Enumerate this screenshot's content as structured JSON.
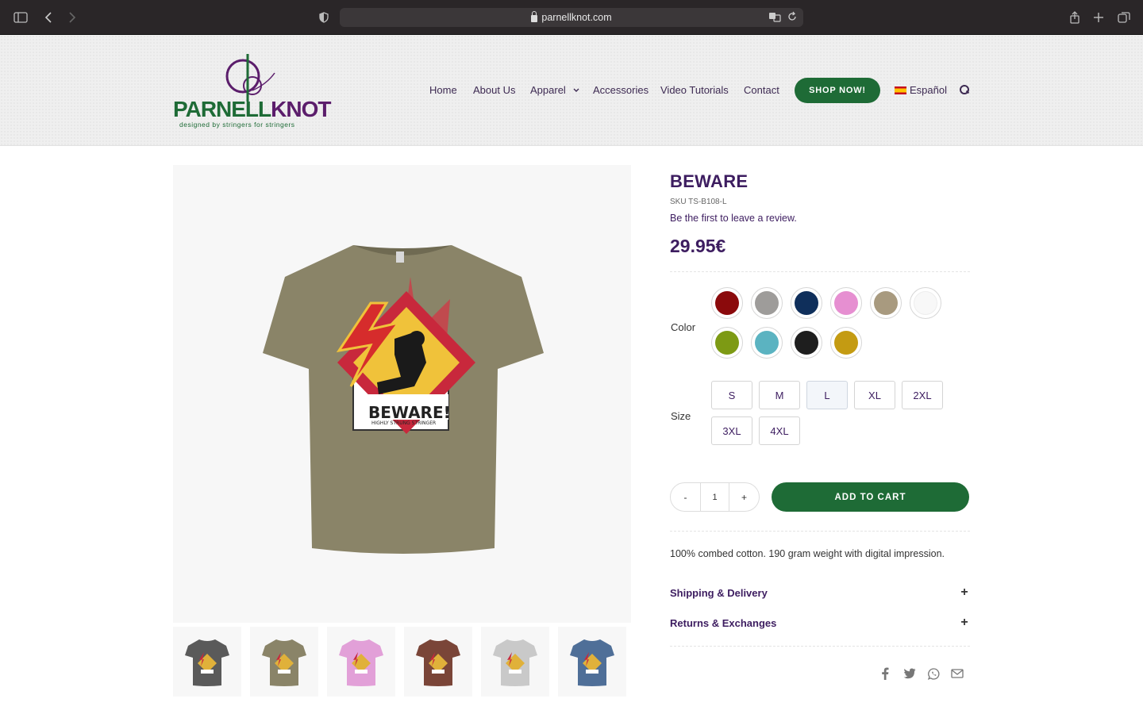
{
  "browser": {
    "url": "parnellknot.com"
  },
  "header": {
    "logo_brand_a": "PARNELL",
    "logo_brand_b": "KNOT",
    "logo_tagline": "designed by stringers for stringers",
    "nav": {
      "home": "Home",
      "about": "About Us",
      "apparel": "Apparel",
      "accessories": "Accessories",
      "tutorials": "Video Tutorials",
      "contact": "Contact",
      "shop": "SHOP NOW!",
      "language": "Español"
    }
  },
  "product": {
    "title": "BEWARE",
    "sku": "SKU TS-B108-L",
    "review_link": "Be the first to leave a review.",
    "price": "29.95€",
    "color_label": "Color",
    "colors": [
      "#8b0a0c",
      "#9e9c9a",
      "#0f2f5b",
      "#e68fd1",
      "#a89a7f",
      "#f8f8f8",
      "#7d9a14",
      "#5bb3c1",
      "#1e1e1e",
      "#c49b12"
    ],
    "size_label": "Size",
    "sizes": [
      "S",
      "M",
      "L",
      "XL",
      "2XL",
      "3XL",
      "4XL"
    ],
    "selected_size": "L",
    "quantity": "1",
    "qty_minus": "-",
    "qty_plus": "+",
    "add_to_cart": "ADD TO CART",
    "description": "100% combed cotton. 190 gram weight with digital impression.",
    "shipping_title": "Shipping & Delivery",
    "returns_title": "Returns & Exchanges",
    "accordion_icon": "+",
    "shirt_color": "#8a8468",
    "design_text": "BEWARE!",
    "design_subtext": "HIGHLY STRUNG STRINGER",
    "thumbnails": [
      "#5a5a5a",
      "#8a8468",
      "#e2a0d8",
      "#7a4538",
      "#c9c9c9",
      "#4f6f98"
    ]
  },
  "share": {
    "facebook": "f",
    "icons": [
      "facebook-icon",
      "twitter-icon",
      "whatsapp-icon",
      "email-icon"
    ]
  }
}
